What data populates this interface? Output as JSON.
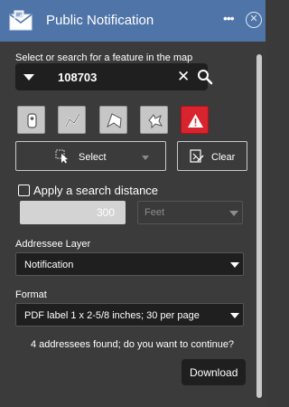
{
  "header": {
    "title": "Public Notification",
    "app_icon": "envelope-map-icon",
    "more_glyph": "•••",
    "close_glyph": "✕"
  },
  "feature": {
    "label": "Select or search for a feature in the map",
    "search_value": "108703",
    "clear_glyph": "✕",
    "search_icon": "search-icon"
  },
  "tools": [
    {
      "name": "point-tool-icon"
    },
    {
      "name": "line-tool-icon"
    },
    {
      "name": "polygon-tool-icon"
    },
    {
      "name": "freehand-tool-icon"
    },
    {
      "name": "warning-tool-icon",
      "color": "#d8242e"
    }
  ],
  "select_button": {
    "label": "Select"
  },
  "clear_button": {
    "label": "Clear"
  },
  "search_distance": {
    "label": "Apply a search distance",
    "checked": false,
    "value": "300",
    "unit": "Feet"
  },
  "addressee_layer": {
    "label": "Addressee Layer",
    "value": "Notification"
  },
  "format": {
    "label": "Format",
    "value": "PDF label 1 x 2-5/8 inches; 30 per page"
  },
  "message": "4 addressees found; do you want to continue?",
  "download_button": {
    "label": "Download"
  },
  "colors": {
    "header": "#4f74a8",
    "panel": "#3b3b3b",
    "warning": "#d8242e"
  }
}
